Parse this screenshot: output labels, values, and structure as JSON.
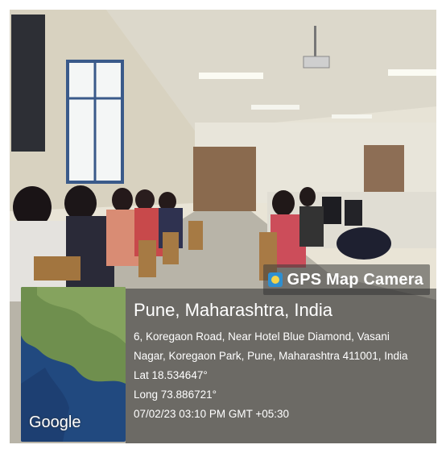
{
  "overlay": {
    "app_label": "GPS Map Camera",
    "app_icon": "gps-map-camera-icon",
    "map_label": "Google",
    "location_title": "Pune, Maharashtra, India",
    "address_line1": "6, Koregaon Road, Near Hotel Blue Diamond, Vasani",
    "address_line2": "Nagar, Koregaon Park, Pune, Maharashtra 411001, India",
    "lat": "Lat 18.534647°",
    "long": "Long 73.886721°",
    "datetime": "07/02/23 03:10 PM GMT +05:30"
  }
}
